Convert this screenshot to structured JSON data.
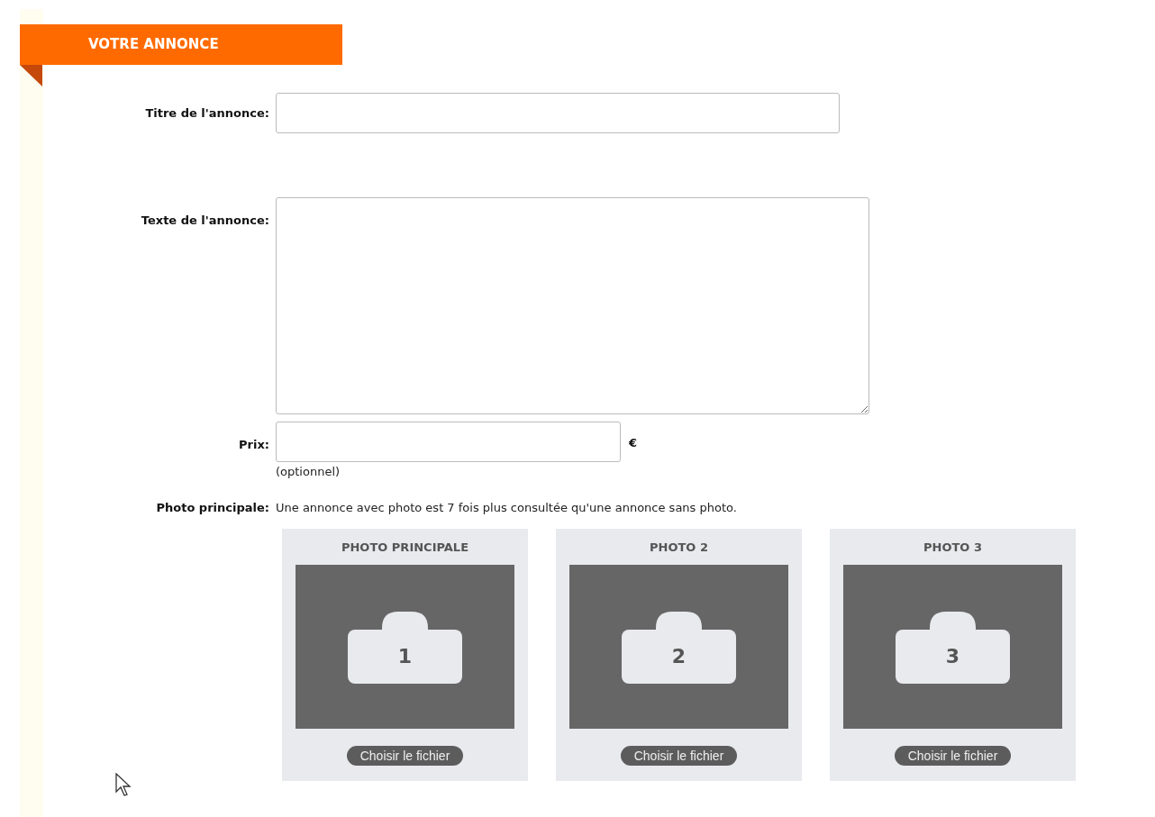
{
  "section": {
    "title": "VOTRE ANNONCE"
  },
  "fields": [
    {
      "kind": "input",
      "label": "Titre de l'annonce:"
    },
    {
      "kind": "textarea",
      "label": "Texte de l'annonce:"
    },
    {
      "kind": "price",
      "label": "Prix:",
      "unit": "€",
      "note": "(optionnel)"
    }
  ],
  "photos": {
    "label": "Photo principale:",
    "hint": "Une annonce avec photo est 7 fois plus consultée qu'une annonce sans photo.",
    "slots": [
      {
        "title": "PHOTO PRINCIPALE",
        "number": "1",
        "button": "Choisir le fichier"
      },
      {
        "title": "PHOTO 2",
        "number": "2",
        "button": "Choisir le fichier"
      },
      {
        "title": "PHOTO 3",
        "number": "3",
        "button": "Choisir le fichier"
      }
    ]
  }
}
